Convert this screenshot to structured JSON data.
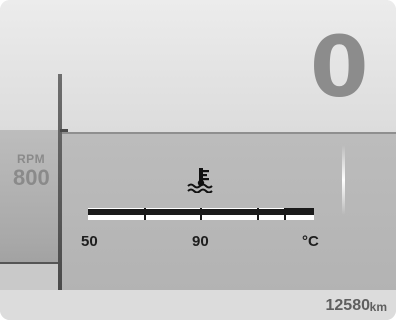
{
  "tachometer": {
    "label": "RPM",
    "value": "800"
  },
  "speedometer": {
    "value": "0"
  },
  "coolant_temperature": {
    "icon": "coolant-temperature-icon",
    "scale_labels": {
      "min": "50",
      "mid": "90",
      "unit": "°C"
    },
    "level_fraction": 0.0
  },
  "odometer": {
    "value": "12580",
    "unit": "km"
  },
  "colors": {
    "gauge_bar": "#1a1a1a",
    "gauge_track": "#ffffff",
    "digits": "#8c8c8c"
  }
}
